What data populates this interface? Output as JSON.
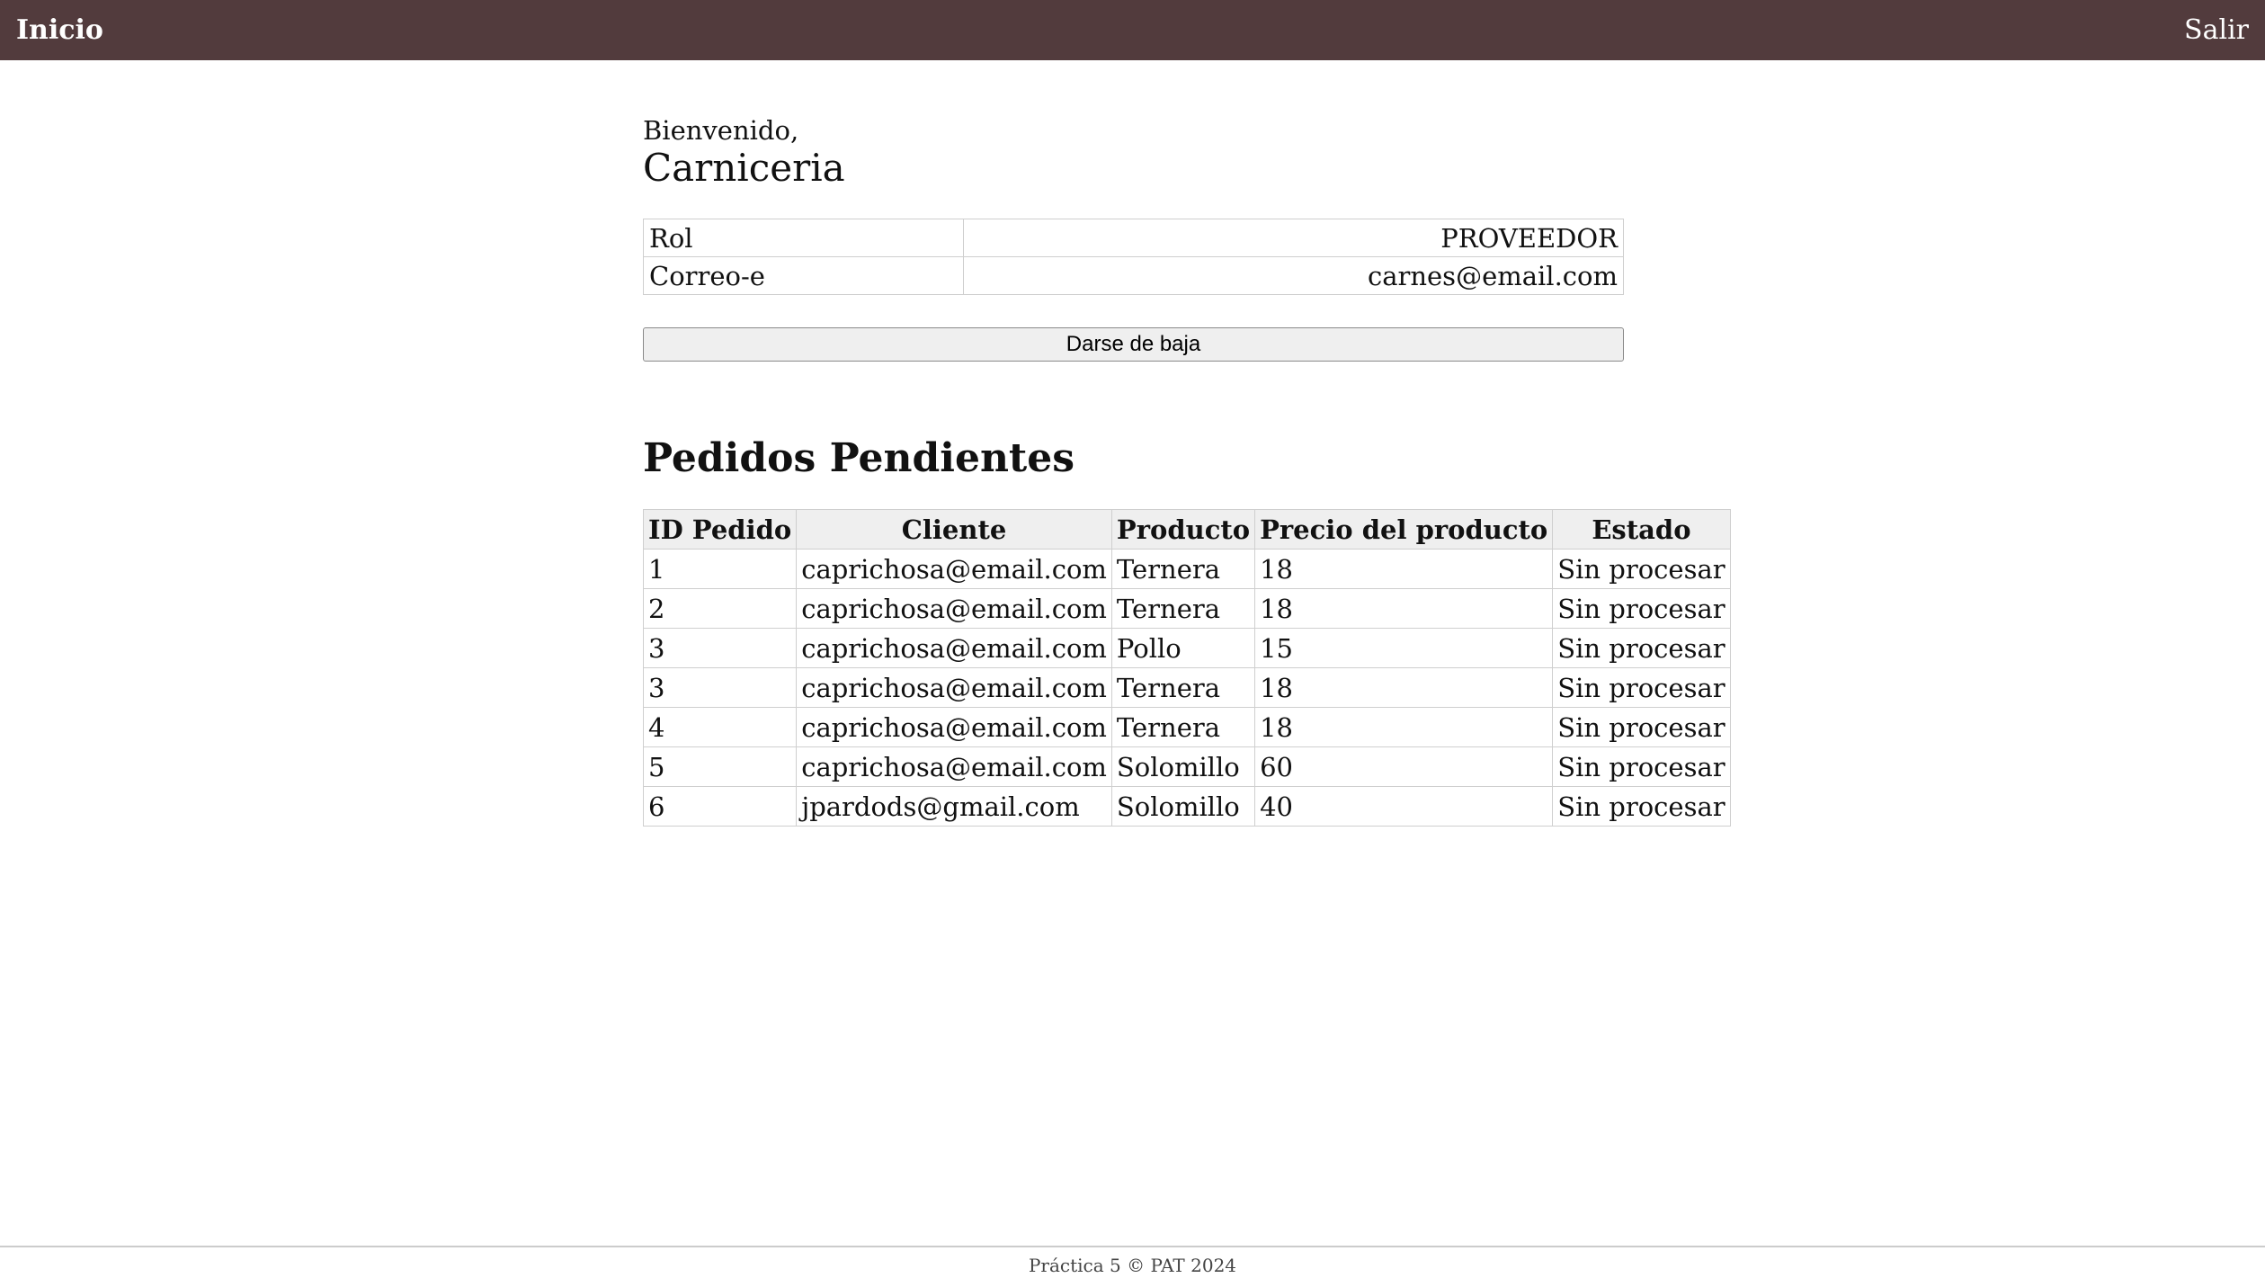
{
  "navbar": {
    "home_label": "Inicio",
    "logout_label": "Salir",
    "background_color": "#523b3d"
  },
  "profile": {
    "welcome": "Bienvenido,",
    "name": "Carniceria",
    "fields": [
      {
        "label": "Rol",
        "value": "PROVEEDOR"
      },
      {
        "label": "Correo-e",
        "value": "carnes@email.com"
      }
    ],
    "unsubscribe_label": "Darse de baja"
  },
  "orders": {
    "title": "Pedidos Pendientes",
    "columns": [
      "ID Pedido",
      "Cliente",
      "Producto",
      "Precio del producto",
      "Estado"
    ],
    "rows": [
      [
        "1",
        "caprichosa@email.com",
        "Ternera",
        "18",
        "Sin procesar"
      ],
      [
        "2",
        "caprichosa@email.com",
        "Ternera",
        "18",
        "Sin procesar"
      ],
      [
        "3",
        "caprichosa@email.com",
        "Pollo",
        "15",
        "Sin procesar"
      ],
      [
        "3",
        "caprichosa@email.com",
        "Ternera",
        "18",
        "Sin procesar"
      ],
      [
        "4",
        "caprichosa@email.com",
        "Ternera",
        "18",
        "Sin procesar"
      ],
      [
        "5",
        "caprichosa@email.com",
        "Solomillo",
        "60",
        "Sin procesar"
      ],
      [
        "6",
        "jpardods@gmail.com",
        "Solomillo",
        "40",
        "Sin procesar"
      ]
    ]
  },
  "footer": {
    "text": "Práctica 5 © PAT 2024"
  }
}
